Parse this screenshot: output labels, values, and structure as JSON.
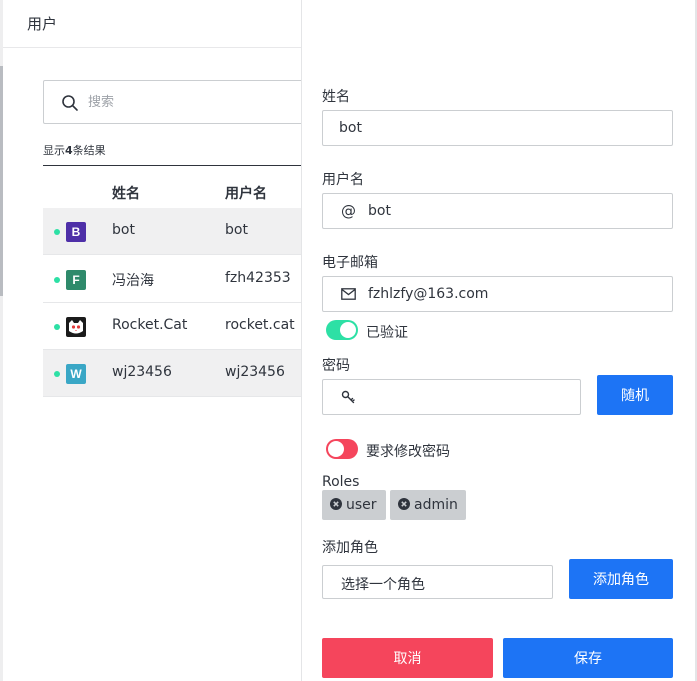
{
  "header": {
    "title": "用户"
  },
  "search": {
    "placeholder": "搜索"
  },
  "results": {
    "prefix": "显示",
    "count": "4",
    "suffix": "条结果"
  },
  "table": {
    "columns": [
      "姓名",
      "用户名"
    ],
    "rows": [
      {
        "avatar_letter": "B",
        "avatar_color": "#4e2fa8",
        "name": "bot",
        "username": "bot",
        "status": "online"
      },
      {
        "avatar_letter": "F",
        "avatar_color": "#2e8a6b",
        "name": "冯治海",
        "username": "fzh42353",
        "status": "online"
      },
      {
        "avatar_letter": "",
        "avatar_icon": "rocket-cat-icon",
        "name": "Rocket.Cat",
        "username": "rocket.cat",
        "status": "online"
      },
      {
        "avatar_letter": "W",
        "avatar_color": "#3aa7c6",
        "name": "wj23456",
        "username": "wj23456",
        "status": "online"
      }
    ]
  },
  "form": {
    "name_label": "姓名",
    "name_value": "bot",
    "username_label": "用户名",
    "username_prefix": "@",
    "username_value": "bot",
    "email_label": "电子邮箱",
    "email_value": "fzhlzfy@163.com",
    "verified_label": "已验证",
    "verified": true,
    "password_label": "密码",
    "random_button": "随机",
    "require_change_label": "要求修改密码",
    "require_change": false,
    "roles_label": "Roles",
    "roles": [
      "user",
      "admin"
    ],
    "add_role_label": "添加角色",
    "select_placeholder": "选择一个角色",
    "add_role_button": "添加角色",
    "cancel_button": "取消",
    "save_button": "保存"
  },
  "colors": {
    "accent": "#1d74f5",
    "danger": "#f5455c",
    "success": "#2de0a5"
  }
}
